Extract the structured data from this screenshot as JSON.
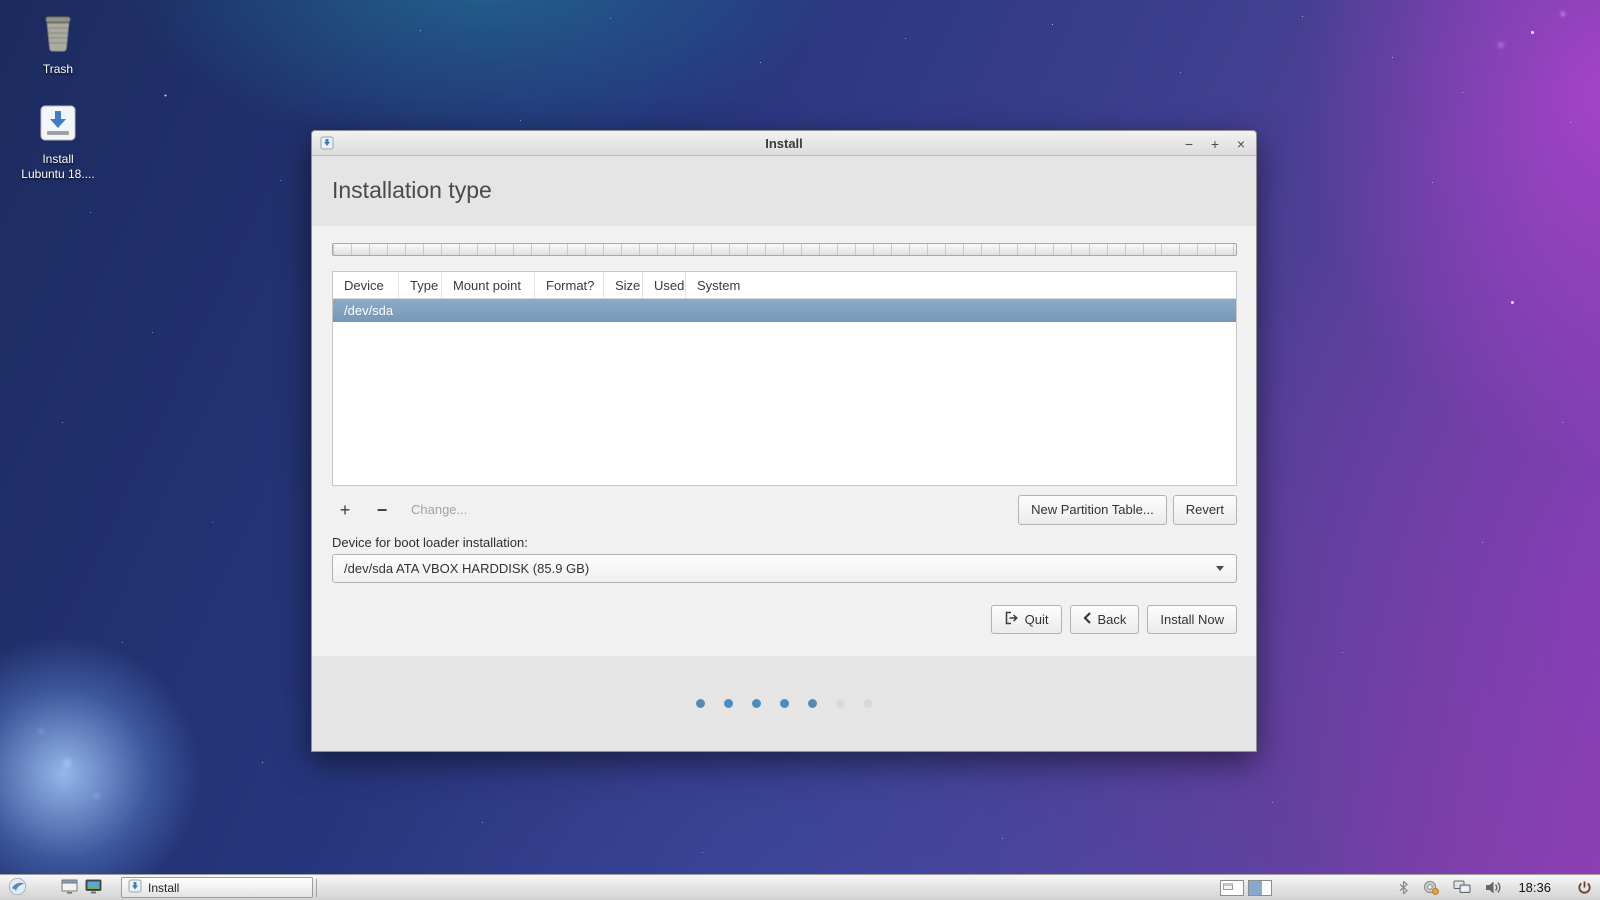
{
  "colors": {
    "selection_row": "#7d9fc0",
    "dot_active": "#4f8cbe",
    "dot_inactive": "#d9d9d9"
  },
  "desktop": {
    "trash_label": "Trash",
    "install_label_line1": "Install",
    "install_label_line2": "Lubuntu 18...."
  },
  "installer": {
    "window_title": "Install",
    "controls": {
      "minimize": "−",
      "maximize": "+",
      "close": "×"
    },
    "heading": "Installation type",
    "partition_table": {
      "columns": [
        "Device",
        "Type",
        "Mount point",
        "Format?",
        "Size",
        "Used",
        "System"
      ],
      "rows": [
        {
          "device": "/dev/sda"
        }
      ]
    },
    "actions": {
      "add": "+",
      "remove": "−",
      "change": "Change...",
      "new_partition_table": "New Partition Table...",
      "revert": "Revert"
    },
    "bootloader_label": "Device for boot loader installation:",
    "bootloader_value": "/dev/sda ATA VBOX HARDDISK (85.9 GB)",
    "nav": {
      "quit": "Quit",
      "back": "Back",
      "install_now": "Install Now"
    },
    "progress": {
      "total_dots": 7,
      "active_dots": 5
    }
  },
  "taskbar": {
    "task_button_label": "Install",
    "clock": "18:36"
  }
}
